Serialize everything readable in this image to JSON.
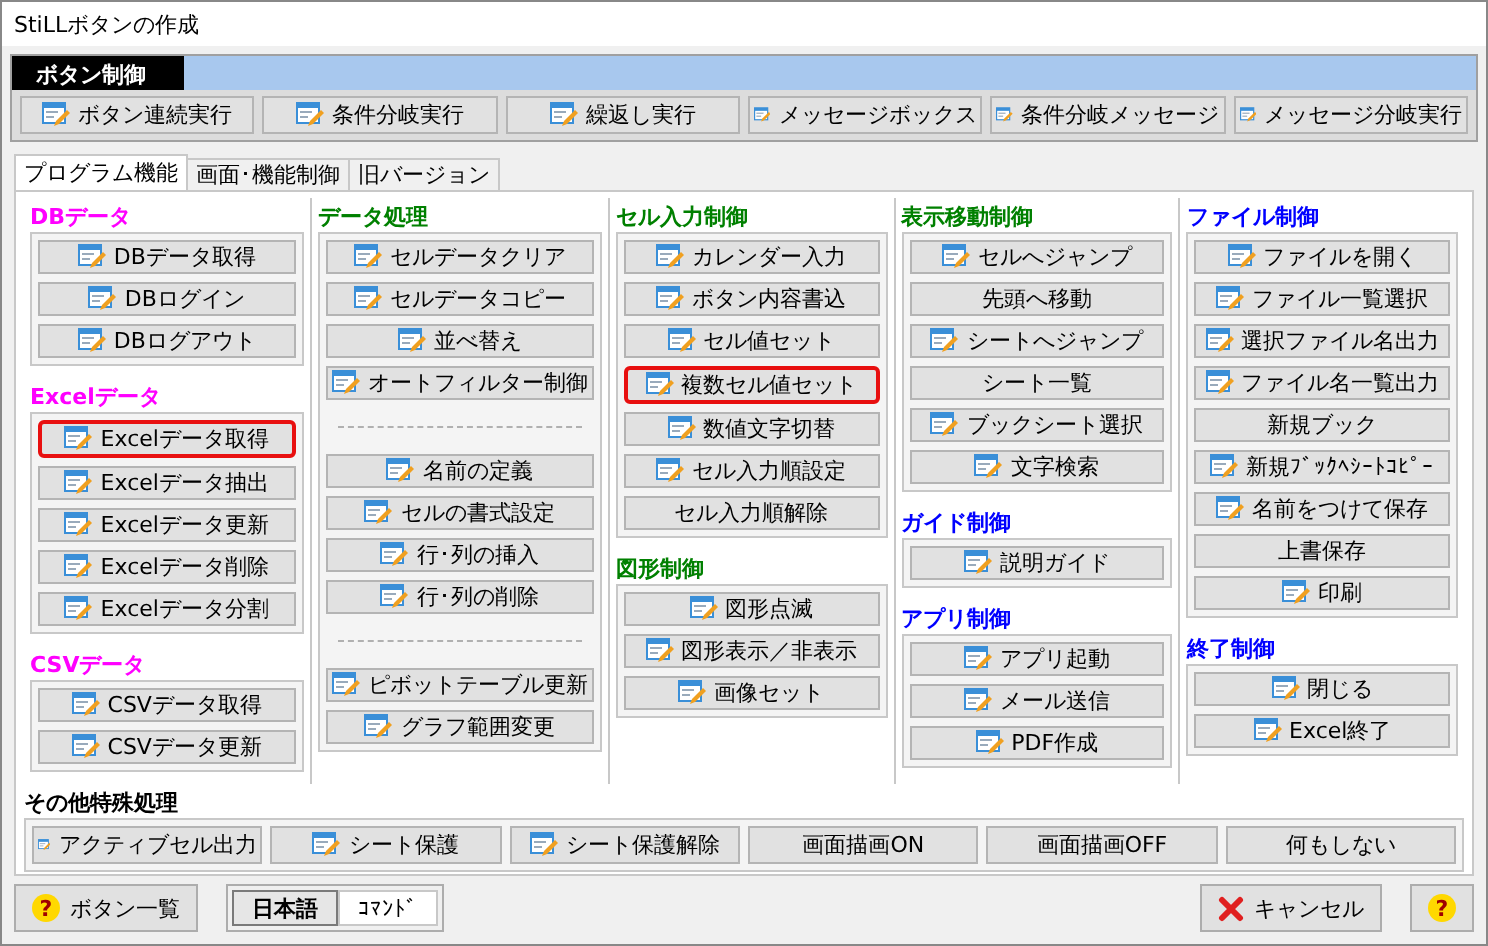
{
  "window": {
    "title": "StiLLボタンの作成"
  },
  "button_control": {
    "label": "ボタン制御",
    "buttons": [
      {
        "label": "ボタン連続実行",
        "icon": true
      },
      {
        "label": "条件分岐実行",
        "icon": true
      },
      {
        "label": "繰返し実行",
        "icon": true
      },
      {
        "label": "メッセージボックス",
        "icon": true
      },
      {
        "label": "条件分岐メッセージ",
        "icon": true
      },
      {
        "label": "メッセージ分岐実行",
        "icon": true
      }
    ]
  },
  "tabs": [
    {
      "label": "プログラム機能",
      "selected": true
    },
    {
      "label": "画面･機能制御",
      "selected": false
    },
    {
      "label": "旧バージョン",
      "selected": false
    }
  ],
  "columns": [
    {
      "sections": [
        {
          "title": "DBデータ",
          "color": "#ff00ff",
          "items": [
            {
              "kind": "button",
              "label": "DBデータ取得",
              "icon": true,
              "highlighted": false
            },
            {
              "kind": "button",
              "label": "DBログイン",
              "icon": true,
              "highlighted": false
            },
            {
              "kind": "button",
              "label": "DBログアウト",
              "icon": true,
              "highlighted": false
            }
          ]
        },
        {
          "title": "Excelデータ",
          "color": "#ff00ff",
          "items": [
            {
              "kind": "button",
              "label": "Excelデータ取得",
              "icon": true,
              "highlighted": true
            },
            {
              "kind": "button",
              "label": "Excelデータ抽出",
              "icon": true,
              "highlighted": false
            },
            {
              "kind": "button",
              "label": "Excelデータ更新",
              "icon": true,
              "highlighted": false
            },
            {
              "kind": "button",
              "label": "Excelデータ削除",
              "icon": true,
              "highlighted": false
            },
            {
              "kind": "button",
              "label": "Excelデータ分割",
              "icon": true,
              "highlighted": false
            }
          ]
        },
        {
          "title": "CSVデータ",
          "color": "#ff00ff",
          "items": [
            {
              "kind": "button",
              "label": "CSVデータ取得",
              "icon": true,
              "highlighted": false
            },
            {
              "kind": "button",
              "label": "CSVデータ更新",
              "icon": true,
              "highlighted": false
            }
          ]
        }
      ]
    },
    {
      "sections": [
        {
          "title": "データ処理",
          "color": "#008000",
          "items": [
            {
              "kind": "button",
              "label": "セルデータクリア",
              "icon": true,
              "highlighted": false
            },
            {
              "kind": "button",
              "label": "セルデータコピー",
              "icon": true,
              "highlighted": false
            },
            {
              "kind": "button",
              "label": "並べ替え",
              "icon": true,
              "highlighted": false
            },
            {
              "kind": "button",
              "label": "オートフィルター制御",
              "icon": true,
              "highlighted": false
            },
            {
              "kind": "separator"
            },
            {
              "kind": "button",
              "label": "名前の定義",
              "icon": true,
              "highlighted": false
            },
            {
              "kind": "button",
              "label": "セルの書式設定",
              "icon": true,
              "highlighted": false
            },
            {
              "kind": "button",
              "label": "行･列の挿入",
              "icon": true,
              "highlighted": false
            },
            {
              "kind": "button",
              "label": "行･列の削除",
              "icon": true,
              "highlighted": false
            },
            {
              "kind": "separator"
            },
            {
              "kind": "button",
              "label": "ピボットテーブル更新",
              "icon": true,
              "highlighted": false
            },
            {
              "kind": "button",
              "label": "グラフ範囲変更",
              "icon": true,
              "highlighted": false
            }
          ]
        }
      ]
    },
    {
      "sections": [
        {
          "title": "セル入力制御",
          "color": "#008000",
          "items": [
            {
              "kind": "button",
              "label": "カレンダー入力",
              "icon": true,
              "highlighted": false
            },
            {
              "kind": "button",
              "label": "ボタン内容書込",
              "icon": true,
              "highlighted": false
            },
            {
              "kind": "button",
              "label": "セル値セット",
              "icon": true,
              "highlighted": false
            },
            {
              "kind": "button",
              "label": "複数セル値セット",
              "icon": true,
              "highlighted": true
            },
            {
              "kind": "button",
              "label": "数値文字切替",
              "icon": true,
              "highlighted": false
            },
            {
              "kind": "button",
              "label": "セル入力順設定",
              "icon": true,
              "highlighted": false
            },
            {
              "kind": "button",
              "label": "セル入力順解除",
              "icon": false,
              "highlighted": false
            }
          ]
        },
        {
          "title": "図形制御",
          "color": "#008000",
          "items": [
            {
              "kind": "button",
              "label": "図形点滅",
              "icon": true,
              "highlighted": false
            },
            {
              "kind": "button",
              "label": "図形表示／非表示",
              "icon": true,
              "highlighted": false
            },
            {
              "kind": "button",
              "label": "画像セット",
              "icon": true,
              "highlighted": false
            }
          ]
        }
      ]
    },
    {
      "sections": [
        {
          "title": "表示移動制御",
          "color": "#008000",
          "items": [
            {
              "kind": "button",
              "label": "セルへジャンプ",
              "icon": true,
              "highlighted": false
            },
            {
              "kind": "button",
              "label": "先頭へ移動",
              "icon": false,
              "highlighted": false
            },
            {
              "kind": "button",
              "label": "シートへジャンプ",
              "icon": true,
              "highlighted": false
            },
            {
              "kind": "button",
              "label": "シート一覧",
              "icon": false,
              "highlighted": false
            },
            {
              "kind": "button",
              "label": "ブックシート選択",
              "icon": true,
              "highlighted": false
            },
            {
              "kind": "button",
              "label": "文字検索",
              "icon": true,
              "highlighted": false
            }
          ]
        },
        {
          "title": "ガイド制御",
          "color": "#0000ff",
          "items": [
            {
              "kind": "button",
              "label": "説明ガイド",
              "icon": true,
              "highlighted": false
            }
          ]
        },
        {
          "title": "アプリ制御",
          "color": "#0000ff",
          "items": [
            {
              "kind": "button",
              "label": "アプリ起動",
              "icon": true,
              "highlighted": false
            },
            {
              "kind": "button",
              "label": "メール送信",
              "icon": true,
              "highlighted": false
            },
            {
              "kind": "button",
              "label": "PDF作成",
              "icon": true,
              "highlighted": false
            }
          ]
        }
      ]
    },
    {
      "sections": [
        {
          "title": "ファイル制御",
          "color": "#0000ff",
          "items": [
            {
              "kind": "button",
              "label": "ファイルを開く",
              "icon": true,
              "highlighted": false
            },
            {
              "kind": "button",
              "label": "ファイル一覧選択",
              "icon": true,
              "highlighted": false
            },
            {
              "kind": "button",
              "label": "選択ファイル名出力",
              "icon": true,
              "highlighted": false
            },
            {
              "kind": "button",
              "label": "ファイル名一覧出力",
              "icon": true,
              "highlighted": false
            },
            {
              "kind": "button",
              "label": "新規ブック",
              "icon": false,
              "highlighted": false
            },
            {
              "kind": "button",
              "label": "新規ﾌﾞｯｸﾍｼｰﾄｺﾋﾟｰ",
              "icon": true,
              "highlighted": false
            },
            {
              "kind": "button",
              "label": "名前をつけて保存",
              "icon": true,
              "highlighted": false
            },
            {
              "kind": "button",
              "label": "上書保存",
              "icon": false,
              "highlighted": false
            },
            {
              "kind": "button",
              "label": "印刷",
              "icon": true,
              "highlighted": false
            }
          ]
        },
        {
          "title": "終了制御",
          "color": "#0000ff",
          "items": [
            {
              "kind": "button",
              "label": "閉じる",
              "icon": true,
              "highlighted": false
            },
            {
              "kind": "button",
              "label": "Excel終了",
              "icon": true,
              "highlighted": false
            }
          ]
        }
      ]
    }
  ],
  "other": {
    "title": "その他特殊処理",
    "color": "#000000",
    "items": [
      {
        "kind": "button",
        "label": "アクティブセル出力",
        "icon": true,
        "highlighted": false
      },
      {
        "kind": "button",
        "label": "シート保護",
        "icon": true,
        "highlighted": false
      },
      {
        "kind": "button",
        "label": "シート保護解除",
        "icon": true,
        "highlighted": false
      },
      {
        "kind": "button",
        "label": "画面描画ON",
        "icon": false,
        "highlighted": false
      },
      {
        "kind": "button",
        "label": "画面描画OFF",
        "icon": false,
        "highlighted": false
      },
      {
        "kind": "button",
        "label": "何もしない",
        "icon": false,
        "highlighted": false
      }
    ]
  },
  "footer": {
    "list_button": {
      "label": "ボタン一覧",
      "icon": "?"
    },
    "languages": [
      {
        "label": "日本語",
        "selected": true
      },
      {
        "label": "ｺﾏﾝﾄﾞ",
        "selected": false
      }
    ],
    "cancel_button": {
      "label": "キャンセル"
    },
    "help_button": {
      "icon": "?"
    }
  }
}
